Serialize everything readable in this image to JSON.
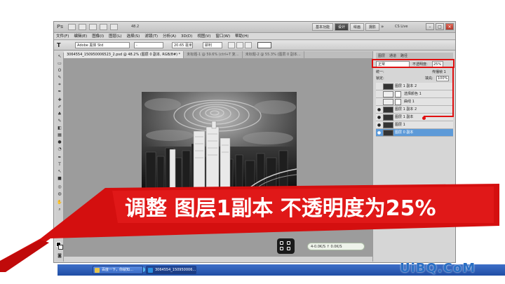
{
  "app": {
    "logo": "Ps",
    "zoom_readout": "48.2",
    "workspaces": [
      "基本功能",
      "设计",
      "绘画",
      "摄影"
    ],
    "active_workspace": "设计",
    "more": "»",
    "cs_live": "CS Live"
  },
  "menu": [
    "文件(F)",
    "编辑(E)",
    "图像(I)",
    "图层(L)",
    "选择(S)",
    "滤镜(T)",
    "分析(A)",
    "3D(D)",
    "视图(V)",
    "窗口(W)",
    "帮助(H)"
  ],
  "options": {
    "tool_glyph": "T",
    "font_family": "Adobe 黑体 Std",
    "font_style": "-",
    "font_size": "20.65 毫米",
    "antialias": "犀利",
    "text_color": "#ffffff"
  },
  "tabs": [
    {
      "label": "3064554_150950006523_2.psd @ 48.2% (图层 0 副本, RGB/8#) *"
    },
    {
      "label": "未标题-1 @ 59.6% (ctrl+T 复…"
    },
    {
      "label": "未标题-2 @ 55.3% (图层 0 副本…"
    }
  ],
  "toolbox_zoom": "48.19%",
  "layers_panel": {
    "tabs": [
      "图层",
      "通道",
      "路径"
    ],
    "blend_mode": "正常",
    "opacity_label": "不透明度:",
    "opacity_value": "25%",
    "unify_label": "统一:",
    "propagate_label": "传播帧 1",
    "lock_label": "锁定:",
    "fill_label": "填充:",
    "fill_value": "100%",
    "layers": [
      {
        "name": "图层 1 副本 2",
        "type": "pixel",
        "visible": false,
        "selected": false
      },
      {
        "name": "选择颜色 1",
        "type": "adjustment",
        "visible": false,
        "selected": false
      },
      {
        "name": "曲线 1",
        "type": "adjustment",
        "visible": false,
        "selected": false
      },
      {
        "name": "图层 1 副本 2",
        "type": "pixel",
        "visible": true,
        "selected": false
      },
      {
        "name": "图层 1 副本",
        "type": "pixel",
        "visible": true,
        "selected": false
      },
      {
        "name": "图层 1",
        "type": "pixel",
        "visible": true,
        "selected": false
      },
      {
        "name": "图层 0 副本",
        "type": "pixel",
        "visible": true,
        "selected": true
      }
    ]
  },
  "overlay": {
    "speed_text": "4-0.0K/S  ↑ 0.0K/S"
  },
  "taskbar": {
    "items": [
      {
        "label": "百度一下，你就知…"
      },
      {
        "label": "3064554_150950006…"
      }
    ]
  },
  "caption": "调整 图层1副本 不透明度为25%",
  "watermark": "UiBQ.CoM",
  "colors": {
    "annotation_red": "#e01010",
    "selected_layer": "#5d9ad8",
    "taskbar_blue": "#2a5ab5"
  }
}
